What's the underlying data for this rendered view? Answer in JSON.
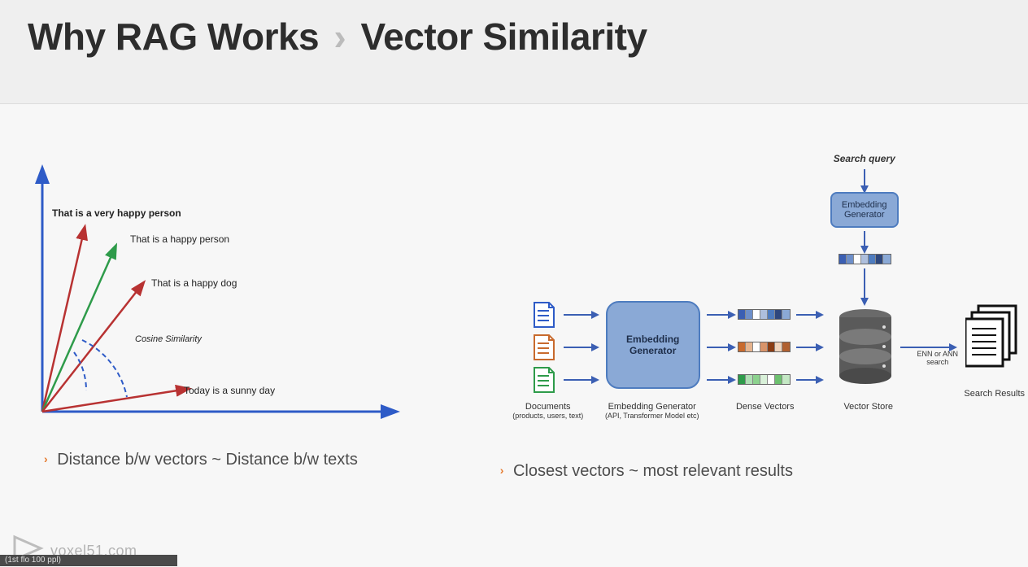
{
  "slide": {
    "title_left": "Why RAG Works",
    "title_right": "Vector Similarity"
  },
  "left": {
    "plot": {
      "vector_labels": [
        "That is a very happy person",
        "That is a happy person",
        "That is a happy dog",
        "Today is a sunny day"
      ],
      "annotation": "Cosine Similarity"
    },
    "bullet": "Distance b/w vectors ~ Distance b/w texts"
  },
  "right": {
    "diagram": {
      "search_query": "Search query",
      "embedding_generator_small": "Embedding Generator",
      "embedding_generator_big": "Embedding Generator",
      "labels": {
        "documents_line1": "Documents",
        "documents_line2": "(products, users, text)",
        "embedgen_line1": "Embedding Generator",
        "embedgen_line2": "(API, Transformer Model etc)",
        "dense_vectors": "Dense Vectors",
        "vector_store": "Vector Store",
        "enn": "ENN or ANN search",
        "search_results": "Search Results"
      }
    },
    "bullet": "Closest vectors ~ most relevant results"
  },
  "footer": {
    "url": "voxel51.com",
    "overlay": "(1st flo 100 ppl)"
  }
}
